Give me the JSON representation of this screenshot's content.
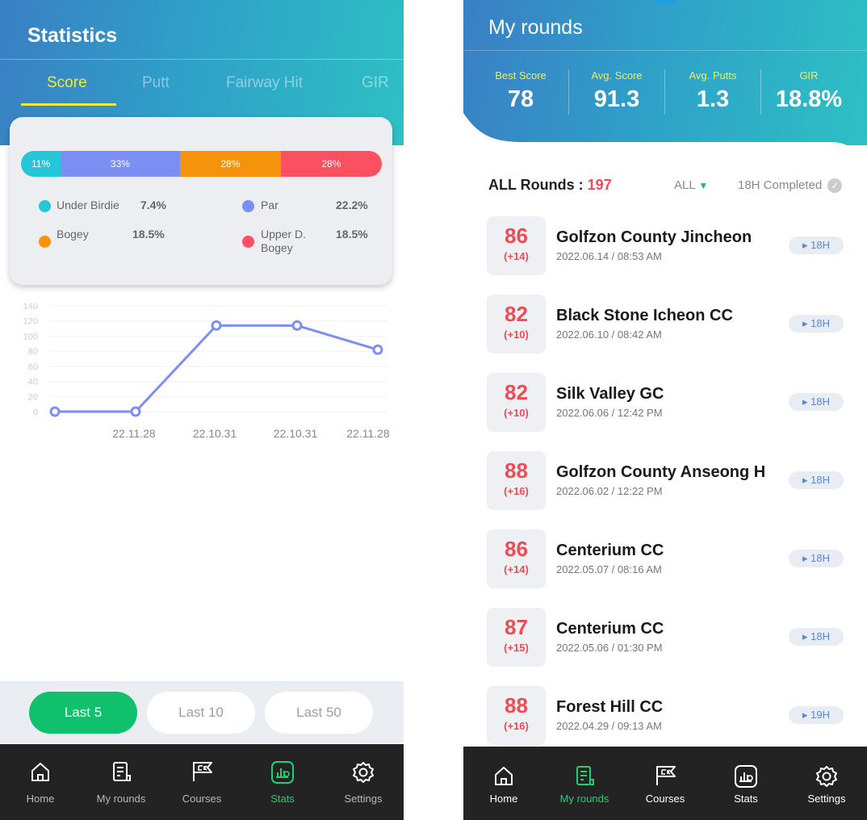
{
  "stats": {
    "title": "Statistics",
    "tabs": [
      {
        "label": "Score",
        "active": true
      },
      {
        "label": "Putt",
        "active": false
      },
      {
        "label": "Fairway Hit",
        "active": false
      },
      {
        "label": "GIR",
        "active": false
      }
    ],
    "distribution": [
      {
        "name": "Under Birdie",
        "bar_label": "11%",
        "share": 11,
        "legend_value": "7.4%",
        "color": "#24c6d8"
      },
      {
        "name": "Par",
        "bar_label": "33%",
        "share": 33,
        "legend_value": "22.2%",
        "color": "#7b8ff3"
      },
      {
        "name": "Bogey",
        "bar_label": "28%",
        "share": 28,
        "legend_value": "18.5%",
        "color": "#f5940c"
      },
      {
        "name": "Upper D. Bogey",
        "bar_label": "28%",
        "share": 28,
        "legend_value": "18.5%",
        "color": "#fb5061"
      }
    ],
    "range_buttons": [
      {
        "label": "Last 5",
        "active": true
      },
      {
        "label": "Last 10",
        "active": false
      },
      {
        "label": "Last 50",
        "active": false
      }
    ]
  },
  "chart_data": {
    "type": "line",
    "x": [
      "",
      "22.11.28",
      "22.10.31",
      "22.10.31",
      "22.11.28"
    ],
    "series": [
      {
        "values": [
          0,
          0,
          114,
          114,
          82
        ]
      }
    ],
    "ylim": [
      0,
      140
    ],
    "yticks": [
      140,
      120,
      100,
      80,
      60,
      40,
      20,
      0
    ],
    "grid": true,
    "color": "#7b8ff3"
  },
  "nav_left": [
    {
      "label": "Home",
      "icon": "home-icon",
      "active": false
    },
    {
      "label": "My rounds",
      "icon": "scorecard-icon",
      "active": false
    },
    {
      "label": "Courses",
      "icon": "flag-icon",
      "active": false
    },
    {
      "label": "Stats",
      "icon": "stats-icon",
      "active": true
    },
    {
      "label": "Settings",
      "icon": "gear-icon",
      "active": false
    }
  ],
  "rounds": {
    "title": "My rounds",
    "summary": [
      {
        "label": "Best Score",
        "value": "78"
      },
      {
        "label": "Avg. Score",
        "value": "91.3"
      },
      {
        "label": "Avg. Putts",
        "value": "1.3"
      },
      {
        "label": "GIR",
        "value": "18.8%"
      }
    ],
    "all_label": "ALL Rounds :",
    "all_count": "197",
    "filter_label": "ALL",
    "filter_completed": "18H Completed",
    "list": [
      {
        "score": "86",
        "diff": "(+14)",
        "course": "Golfzon County Jincheon",
        "date": "2022.06.14 / 08:53 AM",
        "holes": "18H"
      },
      {
        "score": "82",
        "diff": "(+10)",
        "course": "Black Stone Icheon CC",
        "date": "2022.06.10 / 08:42 AM",
        "holes": "18H"
      },
      {
        "score": "82",
        "diff": "(+10)",
        "course": "Silk Valley GC",
        "date": "2022.06.06 / 12:42 PM",
        "holes": "18H"
      },
      {
        "score": "88",
        "diff": "(+16)",
        "course": "Golfzon County Anseong H",
        "date": "2022.06.02 / 12:22 PM",
        "holes": "18H"
      },
      {
        "score": "86",
        "diff": "(+14)",
        "course": "Centerium CC",
        "date": "2022.05.07 / 08:16 AM",
        "holes": "18H"
      },
      {
        "score": "87",
        "diff": "(+15)",
        "course": "Centerium CC",
        "date": "2022.05.06 / 01:30 PM",
        "holes": "18H"
      },
      {
        "score": "88",
        "diff": "(+16)",
        "course": "Forest Hill CC",
        "date": "2022.04.29 / 09:13 AM",
        "holes": "19H"
      }
    ]
  },
  "nav_right": [
    {
      "label": "Home",
      "icon": "home-icon",
      "active": false
    },
    {
      "label": "My rounds",
      "icon": "scorecard-icon",
      "active": true
    },
    {
      "label": "Courses",
      "icon": "flag-icon",
      "active": false
    },
    {
      "label": "Stats",
      "icon": "stats-icon",
      "active": false
    },
    {
      "label": "Settings",
      "icon": "gear-icon",
      "active": false
    }
  ]
}
